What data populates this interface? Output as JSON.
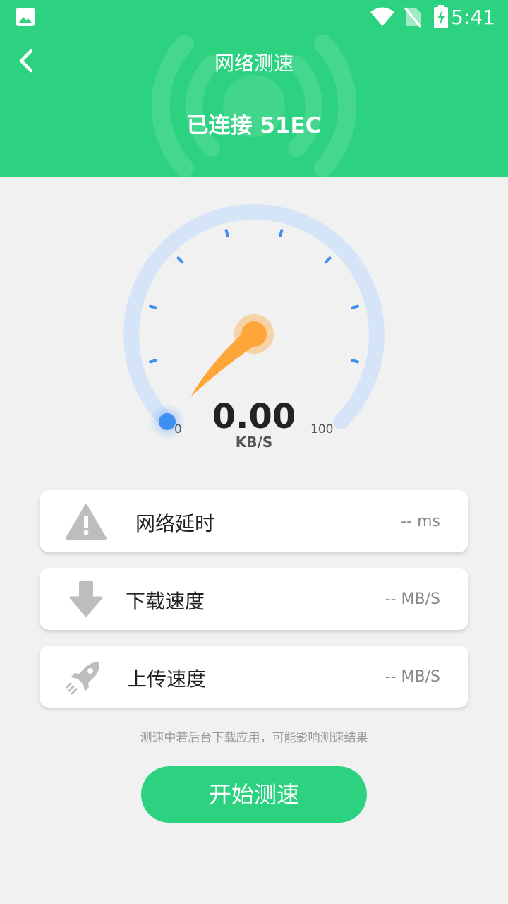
{
  "status_bar": {
    "time": "5:41",
    "icons": [
      "image-icon",
      "wifi-icon",
      "no-sim-icon",
      "battery-charging-icon"
    ]
  },
  "header": {
    "title": "网络测速",
    "connection": "已连接 51EC",
    "back_icon": "chevron-left-icon",
    "color": "#2dd280"
  },
  "gauge": {
    "value": "0.00",
    "unit": "KB/S",
    "min_label": "0",
    "max_label": "100",
    "level": 0,
    "track_color": "#d6e4f8",
    "tick_color": "#3d8ff0",
    "needle_color": "#ffa63a"
  },
  "metrics": [
    {
      "label": "网络延时",
      "value": "-- ms",
      "icon": "warning-icon"
    },
    {
      "label": "下载速度",
      "value": "-- MB/S",
      "icon": "download-arrow-icon"
    },
    {
      "label": "上传速度",
      "value": "-- MB/S",
      "icon": "rocket-icon"
    }
  ],
  "hint": "测速中若后台下载应用，可能影响测速结果",
  "start_button": {
    "label": "开始测速",
    "color": "#2dd280"
  }
}
